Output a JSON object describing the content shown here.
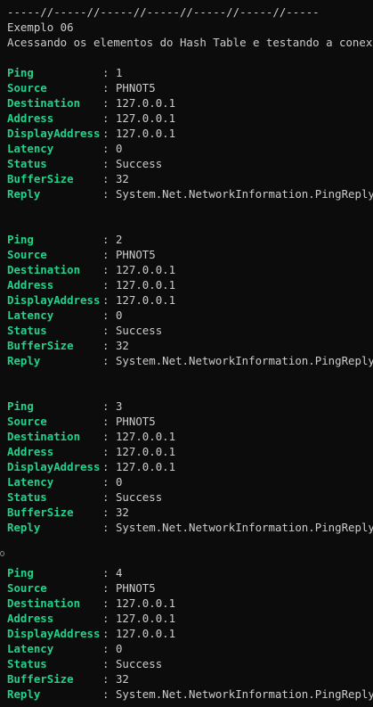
{
  "header": {
    "divider": "-----//-----//-----//-----//-----//-----//-----",
    "example_title": "Exemplo 06",
    "description": "Acessando os elementos do Hash Table e testando a conexão"
  },
  "separator": ":",
  "blocks": [
    {
      "fields": [
        {
          "key": "Ping",
          "value": "1"
        },
        {
          "key": "Source",
          "value": "PHNOT5"
        },
        {
          "key": "Destination",
          "value": "127.0.0.1"
        },
        {
          "key": "Address",
          "value": "127.0.0.1"
        },
        {
          "key": "DisplayAddress",
          "value": "127.0.0.1"
        },
        {
          "key": "Latency",
          "value": "0"
        },
        {
          "key": "Status",
          "value": "Success"
        },
        {
          "key": "BufferSize",
          "value": "32"
        },
        {
          "key": "Reply",
          "value": "System.Net.NetworkInformation.PingReply"
        }
      ]
    },
    {
      "fields": [
        {
          "key": "Ping",
          "value": "2"
        },
        {
          "key": "Source",
          "value": "PHNOT5"
        },
        {
          "key": "Destination",
          "value": "127.0.0.1"
        },
        {
          "key": "Address",
          "value": "127.0.0.1"
        },
        {
          "key": "DisplayAddress",
          "value": "127.0.0.1"
        },
        {
          "key": "Latency",
          "value": "0"
        },
        {
          "key": "Status",
          "value": "Success"
        },
        {
          "key": "BufferSize",
          "value": "32"
        },
        {
          "key": "Reply",
          "value": "System.Net.NetworkInformation.PingReply"
        }
      ]
    },
    {
      "fields": [
        {
          "key": "Ping",
          "value": "3"
        },
        {
          "key": "Source",
          "value": "PHNOT5"
        },
        {
          "key": "Destination",
          "value": "127.0.0.1"
        },
        {
          "key": "Address",
          "value": "127.0.0.1"
        },
        {
          "key": "DisplayAddress",
          "value": "127.0.0.1"
        },
        {
          "key": "Latency",
          "value": "0"
        },
        {
          "key": "Status",
          "value": "Success"
        },
        {
          "key": "BufferSize",
          "value": "32"
        },
        {
          "key": "Reply",
          "value": "System.Net.NetworkInformation.PingReply"
        }
      ]
    },
    {
      "fields": [
        {
          "key": "Ping",
          "value": "4"
        },
        {
          "key": "Source",
          "value": "PHNOT5"
        },
        {
          "key": "Destination",
          "value": "127.0.0.1"
        },
        {
          "key": "Address",
          "value": "127.0.0.1"
        },
        {
          "key": "DisplayAddress",
          "value": "127.0.0.1"
        },
        {
          "key": "Latency",
          "value": "0"
        },
        {
          "key": "Status",
          "value": "Success"
        },
        {
          "key": "BufferSize",
          "value": "32"
        },
        {
          "key": "Reply",
          "value": "System.Net.NetworkInformation.PingReply"
        }
      ]
    }
  ],
  "colors": {
    "background": "#0c0c0c",
    "key": "#23d18b",
    "text": "#cccccc"
  }
}
